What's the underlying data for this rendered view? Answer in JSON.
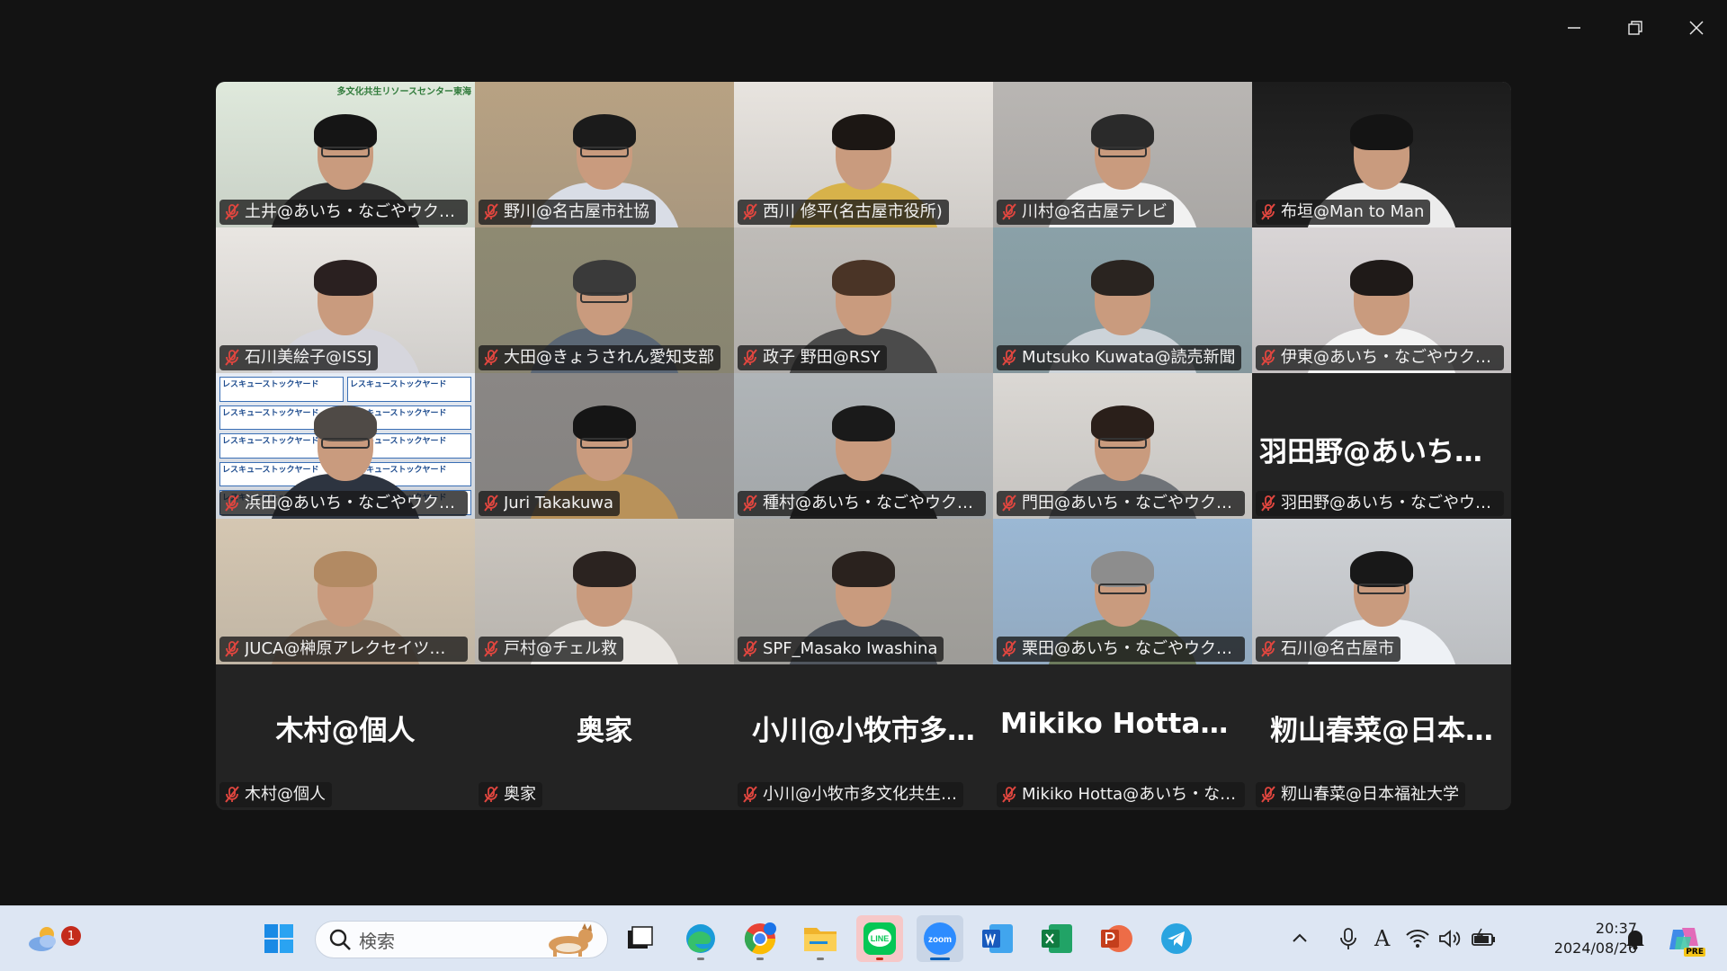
{
  "window": {
    "controls": [
      "minimize-icon",
      "restore-icon",
      "close-icon"
    ]
  },
  "gallery": {
    "rows": [
      [
        {
          "name": "土井@あいち・なごやウクライナ…",
          "video": true,
          "bg": "#dfe9dc",
          "shirt": "#2e2e2e",
          "hair": "#151515",
          "banner": "多文化共生リソースセンター東海",
          "glasses": true
        },
        {
          "name": "野川@名古屋市社協",
          "video": true,
          "bg": "#b8a283",
          "shirt": "#d9dde6",
          "hair": "#1b1b1b",
          "glasses": true
        },
        {
          "name": "西川 修平(名古屋市役所)",
          "video": true,
          "bg": "#e8e4df",
          "shirt": "#d7b24a",
          "hair": "#1c1714"
        },
        {
          "name": "川村@名古屋テレビ",
          "video": true,
          "bg": "#b9b6b3",
          "shirt": "#f1f1f1",
          "hair": "#2a2a2a",
          "glasses": true
        },
        {
          "name": "布垣@Man to Man",
          "video": true,
          "bg": "#1c1c1c",
          "shirt": "#ececec",
          "hair": "#141414"
        }
      ],
      [
        {
          "name": "石川美絵子@ISSJ",
          "video": true,
          "bg": "#e9e6e2",
          "shirt": "#d6d6dd",
          "hair": "#2a2020"
        },
        {
          "name": "大田@きょうされん愛知支部",
          "video": true,
          "bg": "#8e8a72",
          "shirt": "#5b6775",
          "hair": "#3a3a3a",
          "glasses": true
        },
        {
          "name": "政子 野田@RSY",
          "video": true,
          "bg": "#bfbcb8",
          "shirt": "#4b4b4b",
          "hair": "#4a3426"
        },
        {
          "name": "Mutsuko Kuwata@読売新聞",
          "video": true,
          "bg": "#8aa1a8",
          "shirt": "#ccd3d9",
          "hair": "#2a2420"
        },
        {
          "name": "伊東@あいち・なごやウクライナ…",
          "video": true,
          "bg": "#d9d5d6",
          "shirt": "#f3f3f3",
          "hair": "#1f1a18"
        }
      ],
      [
        {
          "name": "浜田@あいち・なごやウクライナ…",
          "video": true,
          "bg": "#e6ecf5",
          "shirt": "#2d3440",
          "hair": "#4f4a46",
          "glasses": true,
          "backdrop": "レスキューストックヤード"
        },
        {
          "name": "Juri Takakuwa",
          "video": true,
          "bg": "#8a8785",
          "shirt": "#b9925a",
          "hair": "#151515",
          "glasses": true
        },
        {
          "name": "種村@あいち・なごやウクライナ…",
          "video": true,
          "bg": "#b0b5b8",
          "shirt": "#1d1d1d",
          "hair": "#1a1a1a"
        },
        {
          "name": "門田@あいち・なごやウクライナ…",
          "video": true,
          "bg": "#dbd8d4",
          "shirt": "#6f7378",
          "hair": "#2a1f1a",
          "glasses": true
        },
        {
          "name": "羽田野@あいち・なごやウクラ…",
          "video": false,
          "display": "羽田野@あいち・…"
        }
      ],
      [
        {
          "name": "JUCA@榊原アレクセイツェヴァ…",
          "video": true,
          "bg": "#d5c7b2",
          "shirt": "#b99f86",
          "hair": "#b28a63"
        },
        {
          "name": "戸村@チェル救",
          "video": true,
          "bg": "#cbc6bf",
          "shirt": "#e9e6e2",
          "hair": "#2b2320"
        },
        {
          "name": "SPF_Masako Iwashina",
          "video": true,
          "bg": "#a9a7a2",
          "shirt": "#50565e",
          "hair": "#2a221e"
        },
        {
          "name": "栗田@あいち・なごやウクライナ…",
          "video": true,
          "bg": "#9bb8d4",
          "shirt": "#6c7a5c",
          "hair": "#8d8d8d",
          "glasses": true
        },
        {
          "name": "石川@名古屋市",
          "video": true,
          "bg": "#cfd2d6",
          "shirt": "#eef1f5",
          "hair": "#181818",
          "glasses": true
        }
      ],
      [
        {
          "name": "木村@個人",
          "video": false,
          "display": "木村@個人"
        },
        {
          "name": "奥家",
          "video": false,
          "display": "奥家"
        },
        {
          "name": "小川@小牧市多文化共生…",
          "video": false,
          "display": "小川@小牧市多…"
        },
        {
          "name": "Mikiko Hotta@あいち・なごや…",
          "video": false,
          "display": "Mikiko Hotta@…"
        },
        {
          "name": "籾山春菜@日本福祉大学",
          "video": false,
          "display": "籾山春菜@日本…"
        }
      ]
    ]
  },
  "taskbar": {
    "search_placeholder": "検索",
    "weather_badge": "1",
    "apps": [
      {
        "name": "start-button",
        "icon": "windows-logo-icon"
      },
      {
        "name": "task-view-button",
        "icon": "task-view-icon"
      },
      {
        "name": "edge-button",
        "icon": "edge-icon"
      },
      {
        "name": "chrome-button",
        "icon": "chrome-icon"
      },
      {
        "name": "file-explorer-button",
        "icon": "folder-icon"
      },
      {
        "name": "line-button",
        "icon": "line-icon"
      },
      {
        "name": "zoom-button",
        "icon": "zoom-icon"
      },
      {
        "name": "word-button",
        "icon": "word-icon"
      },
      {
        "name": "excel-button",
        "icon": "excel-icon"
      },
      {
        "name": "powerpoint-button",
        "icon": "powerpoint-icon"
      },
      {
        "name": "telegram-button",
        "icon": "telegram-icon"
      }
    ],
    "clock": {
      "time": "20:37",
      "date": "2024/08/26"
    },
    "zoom_logo_text": "zoom",
    "line_logo_text": "LINE",
    "ime_text": "A",
    "copilot_badge": "PRE"
  },
  "colors": {
    "accent": "#005fb8",
    "mic_muted": "#e0463f",
    "taskbar_bg": "#dde6f3",
    "window_bg": "#131313"
  }
}
